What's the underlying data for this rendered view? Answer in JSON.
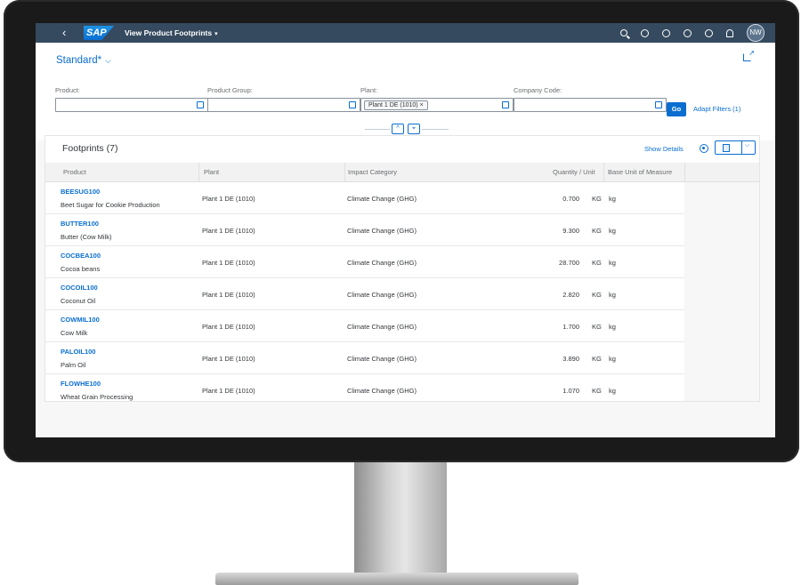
{
  "shell": {
    "back": "‹",
    "logo": "SAP",
    "title": "View Product Footprints",
    "title_caret": "▾",
    "avatar": "NW"
  },
  "header": {
    "variant": "Standard*",
    "variant_chevron": "⌵",
    "filters": [
      {
        "label": "Product:",
        "value": ""
      },
      {
        "label": "Product Group:",
        "value": ""
      },
      {
        "label": "Plant:",
        "value": "Plant 1 DE (1010)"
      },
      {
        "label": "Company Code:",
        "value": ""
      }
    ],
    "plant_token": "Plant 1 DE (1010) ×",
    "go": "Go",
    "adapt_filters": "Adapt Filters (1)",
    "collapse": "^",
    "pin": "⌖"
  },
  "table": {
    "title": "Footprints (7)",
    "show_details": "Show Details",
    "export_dropdown": "⌵",
    "columns": [
      "Product",
      "Plant",
      "Impact Category",
      "Quantity / Unit",
      "Base Unit of Measure"
    ],
    "rows": [
      {
        "code": "BEESUG100",
        "desc": "Beet Sugar for Cookie Production",
        "plant": "Plant 1 DE (1010)",
        "impact": "Climate Change (GHG)",
        "qty": "0.700",
        "unit": "KG",
        "base": "kg"
      },
      {
        "code": "BUTTER100",
        "desc": "Butter (Cow Milk)",
        "plant": "Plant 1 DE (1010)",
        "impact": "Climate Change (GHG)",
        "qty": "9.300",
        "unit": "KG",
        "base": "kg"
      },
      {
        "code": "COCBEA100",
        "desc": "Cocoa beans",
        "plant": "Plant 1 DE (1010)",
        "impact": "Climate Change (GHG)",
        "qty": "28.700",
        "unit": "KG",
        "base": "kg"
      },
      {
        "code": "COCOIL100",
        "desc": "Coconut Oil",
        "plant": "Plant 1 DE (1010)",
        "impact": "Climate Change (GHG)",
        "qty": "2.820",
        "unit": "KG",
        "base": "kg"
      },
      {
        "code": "COWMIL100",
        "desc": "Cow Milk",
        "plant": "Plant 1 DE (1010)",
        "impact": "Climate Change (GHG)",
        "qty": "1.700",
        "unit": "KG",
        "base": "kg"
      },
      {
        "code": "PALOIL100",
        "desc": "Palm Oil",
        "plant": "Plant 1 DE (1010)",
        "impact": "Climate Change (GHG)",
        "qty": "3.890",
        "unit": "KG",
        "base": "kg"
      },
      {
        "code": "FLOWHE100",
        "desc": "Wheat Grain Processing",
        "plant": "Plant 1 DE (1010)",
        "impact": "Climate Change (GHG)",
        "qty": "1.070",
        "unit": "KG",
        "base": "kg"
      }
    ]
  },
  "colors": {
    "shell": "#354a5f",
    "accent": "#0a6ed1"
  }
}
